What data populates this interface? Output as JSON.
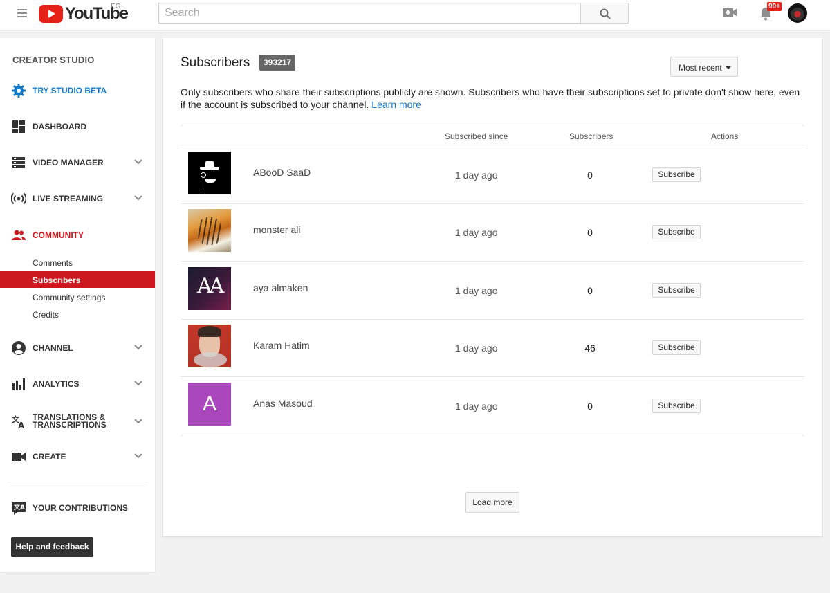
{
  "header": {
    "logo_text": "YouTube",
    "region": "EG",
    "search_placeholder": "Search",
    "notification_count": "99+"
  },
  "sidebar": {
    "title": "CREATOR STUDIO",
    "try_beta": "TRY STUDIO BETA",
    "dashboard": "DASHBOARD",
    "video_manager": "VIDEO MANAGER",
    "live_streaming": "LIVE STREAMING",
    "community": "COMMUNITY",
    "community_sub": [
      "Comments",
      "Subscribers",
      "Community settings",
      "Credits"
    ],
    "channel": "CHANNEL",
    "analytics": "ANALYTICS",
    "translations_line1": "TRANSLATIONS &",
    "translations_line2": "TRANSCRIPTIONS",
    "create": "CREATE",
    "your_contributions": "YOUR CONTRIBUTIONS",
    "help_feedback": "Help and feedback"
  },
  "main": {
    "title": "Subscribers",
    "count": "393217",
    "sort_label": "Most recent",
    "description": "Only subscribers who share their subscriptions publicly are shown. Subscribers who have their subscriptions set to private don't show here, even if the account is subscribed to your channel.",
    "learn_more": "Learn more",
    "columns": {
      "subscribed_since": "Subscribed since",
      "subscribers": "Subscribers",
      "actions": "Actions"
    },
    "rows": [
      {
        "name": "ABooD SaaD",
        "since": "1 day ago",
        "subscribers": "0",
        "action": "Subscribe"
      },
      {
        "name": "monster ali",
        "since": "1 day ago",
        "subscribers": "0",
        "action": "Subscribe"
      },
      {
        "name": "aya almaken",
        "since": "1 day ago",
        "subscribers": "0",
        "action": "Subscribe"
      },
      {
        "name": "Karam Hatim",
        "since": "1 day ago",
        "subscribers": "46",
        "action": "Subscribe"
      },
      {
        "name": "Anas Masoud",
        "since": "1 day ago",
        "subscribers": "0",
        "action": "Subscribe",
        "avatar_letter": "A"
      }
    ],
    "load_more": "Load more"
  },
  "colors": {
    "brand_red": "#e62117",
    "active_red": "#cc181e",
    "link_blue": "#167ac6",
    "anas_avatar": "#ab47bc"
  }
}
